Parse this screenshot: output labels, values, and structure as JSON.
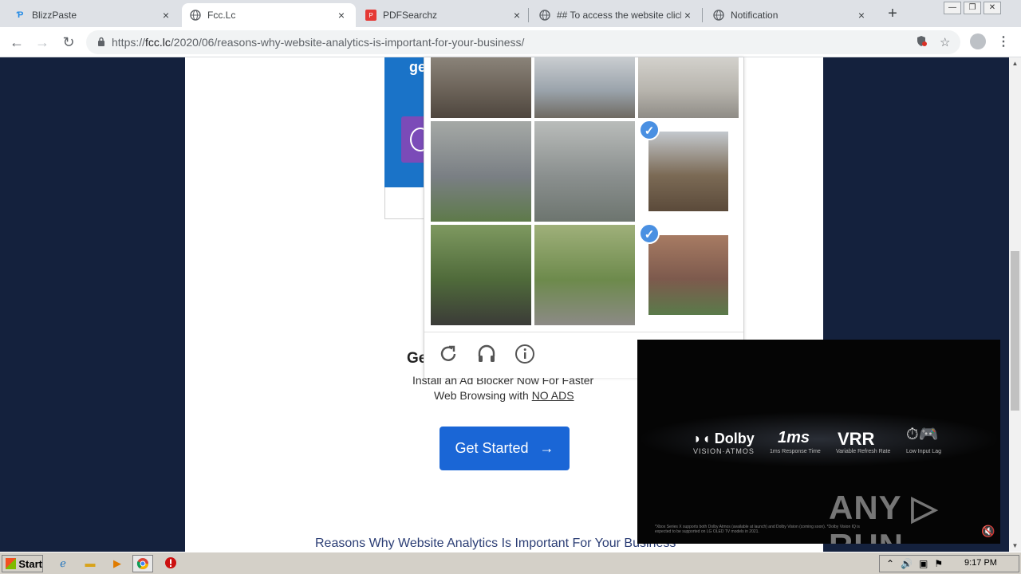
{
  "tabs": [
    {
      "title": "BlizzPaste",
      "icon": "blizzpaste-favicon"
    },
    {
      "title": "Fcc.Lc",
      "icon": "globe-favicon",
      "active": true
    },
    {
      "title": "PDFSearchz",
      "icon": "pdf-favicon"
    },
    {
      "title": "## To access the website click t",
      "icon": "globe-favicon"
    },
    {
      "title": "Notification",
      "icon": "globe-favicon"
    }
  ],
  "tab_close": "×",
  "new_tab": "+",
  "window_controls": {
    "minimize": "—",
    "restore": "❐",
    "close": "✕"
  },
  "address_bar": {
    "scheme": "https://",
    "host": "fcc.lc",
    "path": "/2020/06/reasons-why-website-analytics-is-important-for-your-business/"
  },
  "promo": {
    "heading": "ge"
  },
  "captcha": {
    "selected_tiles": [
      5,
      8
    ],
    "check_mark": "✓",
    "footer_icons": [
      "reload-icon",
      "headphones-icon",
      "info-icon"
    ]
  },
  "adblock": {
    "title": "Ge",
    "line1": "Install an Ad Blocker Now For Faster",
    "line2_prefix": "Web Browsing with ",
    "line2_link": "NO ADS",
    "cta": "Get Started",
    "cta_arrow": "→"
  },
  "article_title": "Reasons Why Website Analytics Is Important For Your Business",
  "video": {
    "dolby": "Dolby",
    "dolby_sub": "VISION·ATMOS",
    "ms": "1ms",
    "ms_sub": "1ms Response Time",
    "vrr": "VRR",
    "vrr_sub": "Variable Refresh Rate",
    "lag_sub": "Low Input Lag",
    "fine_print": "*Xbox Series X supports both Dolby Atmos (available at launch) and Dolby Vision (coming soon). *Dolby Vision IQ is expected to be supported on LG OLED TV models in 2021.",
    "watermark": "ANY ▷ RUN",
    "mute_icon": "🔇"
  },
  "taskbar": {
    "start": "Start",
    "clock": "9:17 PM"
  }
}
